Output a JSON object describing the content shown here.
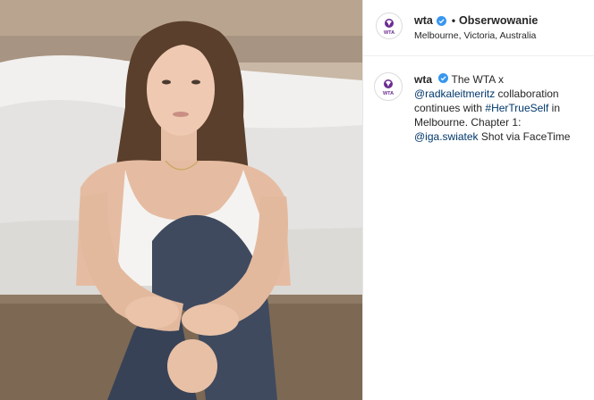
{
  "post": {
    "photo_icon": "portrait-photo",
    "header": {
      "username": "wta",
      "separator": "•",
      "follow_label": "Obserwowanie",
      "location": "Melbourne, Victoria, Australia"
    },
    "caption": {
      "username": "wta",
      "part1": "The WTA x ",
      "mention1": "@radkaleitmeritz",
      "part2": " collaboration continues with ",
      "hashtag": "#HerTrueSelf",
      "part3": " in Melbourne. Chapter 1: ",
      "mention2": "@iga.swiatek",
      "part4": " Shot via FaceTime"
    },
    "avatar_logo": "WTA",
    "colors": {
      "brand": "#6b2c91",
      "verified": "#3897f0",
      "link": "#00376b"
    }
  }
}
